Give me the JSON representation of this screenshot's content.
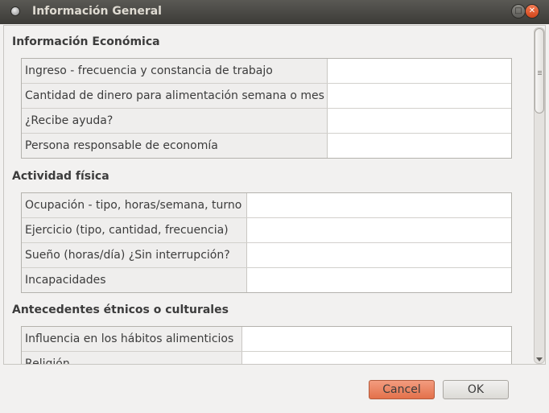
{
  "window": {
    "title": "Información General"
  },
  "sections": [
    {
      "title": "Información Económica",
      "rows": [
        {
          "label": "Ingreso - frecuencia y constancia de trabajo",
          "value": ""
        },
        {
          "label": "Cantidad de dinero para alimentación semana o mes",
          "value": ""
        },
        {
          "label": "¿Recibe ayuda?",
          "value": ""
        },
        {
          "label": "Persona responsable de economía",
          "value": ""
        }
      ]
    },
    {
      "title": "Actividad física",
      "rows": [
        {
          "label": "Ocupación - tipo, horas/semana, turno",
          "value": ""
        },
        {
          "label": "Ejercicio (tipo, cantidad, frecuencia)",
          "value": ""
        },
        {
          "label": "Sueño (horas/día) ¿Sin interrupción?",
          "value": ""
        },
        {
          "label": "Incapacidades",
          "value": ""
        }
      ]
    },
    {
      "title": "Antecedentes étnicos o culturales",
      "rows": [
        {
          "label": "Influencia en los hábitos alimenticios",
          "value": ""
        },
        {
          "label": "Religión",
          "value": ""
        }
      ]
    }
  ],
  "buttons": {
    "cancel_label": "Cancel",
    "ok_label": "OK"
  },
  "icons": {
    "window_menu": "window-menu-icon",
    "maximize": "maximize-icon",
    "close": "close-icon"
  },
  "colors": {
    "titlebar": "#3c3b37",
    "cancel_button": "#e3714b",
    "background": "#f2f1f0"
  }
}
